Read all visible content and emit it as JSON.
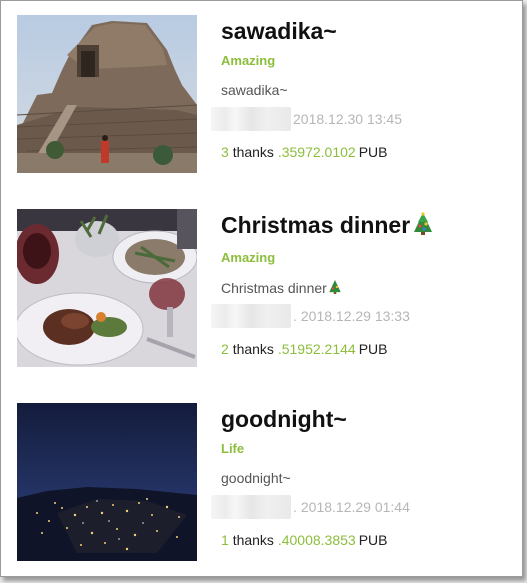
{
  "posts": [
    {
      "title": "sawadika~",
      "category": "Amazing",
      "excerpt": "sawadika~",
      "date_prefix": "",
      "date": "2018.12.30 13:45",
      "thanks_count": "3",
      "thanks_label": "thanks",
      "amount": ".35972.0102",
      "currency": "PUB",
      "image": "temple-photo"
    },
    {
      "title": "Christmas dinner",
      "title_emoji": "christmas-tree-icon",
      "category": "Amazing",
      "excerpt": "Christmas dinner",
      "date_prefix": ".",
      "date": "2018.12.29 13:33",
      "thanks_count": "2",
      "thanks_label": "thanks",
      "amount": ".51952.2144",
      "currency": "PUB",
      "image": "dinner-photo"
    },
    {
      "title": "goodnight~",
      "category": "Life",
      "excerpt": "goodnight~",
      "date_prefix": ".",
      "date": "2018.12.29 01:44",
      "thanks_count": "1",
      "thanks_label": "thanks",
      "amount": ".40008.3853",
      "currency": "PUB",
      "image": "night-city-photo"
    }
  ],
  "colors": {
    "accent": "#8cbe3c",
    "title": "#111111",
    "meta": "#b6b6b6"
  }
}
